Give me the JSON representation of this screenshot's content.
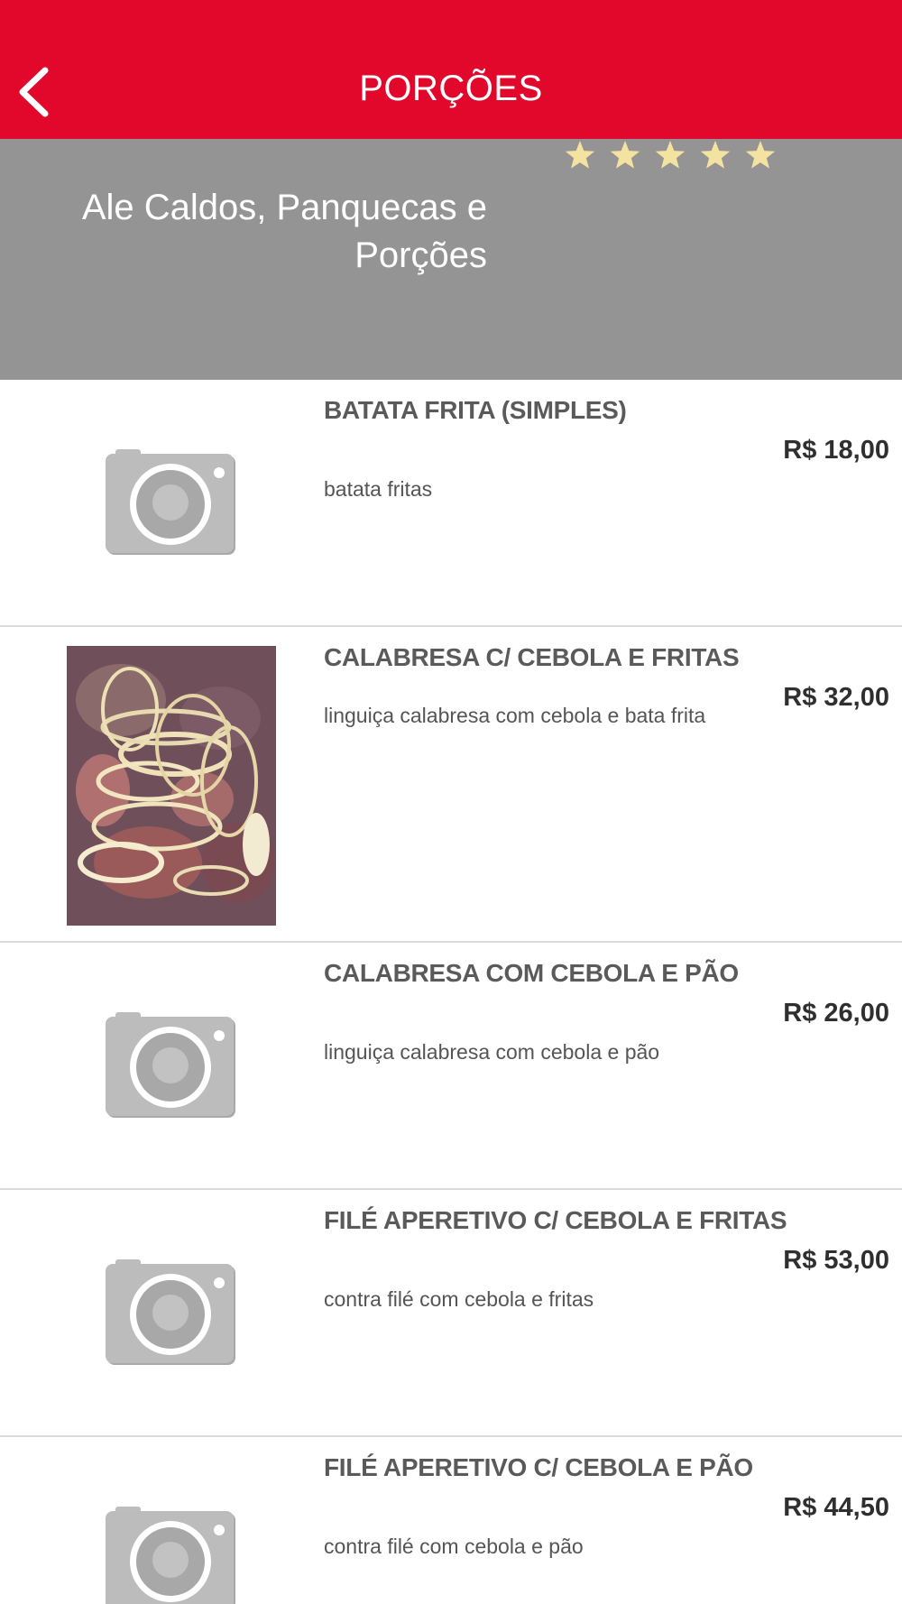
{
  "header": {
    "title": "PORÇÕES",
    "back_icon": "chevron-left-icon",
    "background_color": "#e1082b"
  },
  "store": {
    "name": "Ale Caldos, Panquecas e Porções",
    "rating_stars": 5,
    "banner_color": "#949494",
    "star_color": "#f4e2a0"
  },
  "items": [
    {
      "name": "BATATA FRITA (SIMPLES)",
      "price": "R$ 18,00",
      "description": "batata fritas",
      "image": "camera-placeholder-icon"
    },
    {
      "name": "CALABRESA C/ CEBOLA E FRITAS",
      "price": "R$ 32,00",
      "description": "linguiça calabresa com cebola e bata frita",
      "image": "calabresa-photo"
    },
    {
      "name": "CALABRESA COM CEBOLA E PÃO",
      "price": "R$ 26,00",
      "description": "linguiça calabresa com cebola e pão",
      "image": "camera-placeholder-icon"
    },
    {
      "name": "FILÉ APERETIVO C/ CEBOLA E FRITAS",
      "price": "R$ 53,00",
      "description": "contra filé com cebola e fritas",
      "image": "camera-placeholder-icon"
    },
    {
      "name": "FILÉ APERETIVO C/ CEBOLA E PÃO",
      "price": "R$ 44,50",
      "description": "contra filé com cebola e pão",
      "image": "camera-placeholder-icon"
    }
  ]
}
